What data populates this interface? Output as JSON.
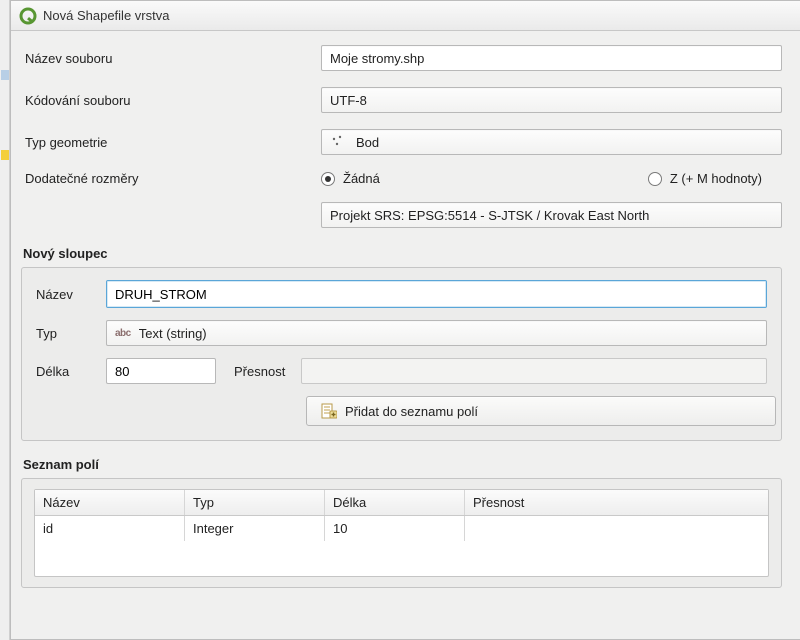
{
  "window": {
    "title": "Nová Shapefile vrstva"
  },
  "labels": {
    "filename": "Název souboru",
    "encoding": "Kódování souboru",
    "geometry": "Typ geometrie",
    "dims": "Dodatečné rozměry",
    "newfield_group": "Nový sloupec",
    "name": "Název",
    "type": "Typ",
    "length": "Délka",
    "precision": "Přesnost",
    "addfield": "Přidat do seznamu polí",
    "fieldlist_group": "Seznam polí"
  },
  "values": {
    "filename": "Moje stromy.shp",
    "encoding": "UTF-8",
    "geometry": "Bod",
    "dims_none": "Žádná",
    "dims_z": "Z (+ M hodnoty)",
    "crs": "Projekt SRS: EPSG:5514 - S-JTSK / Krovak East North",
    "newfield_name": "DRUH_STROM",
    "newfield_type_prefix": "abc",
    "newfield_type": "Text (string)",
    "newfield_length": "80"
  },
  "table": {
    "headers": {
      "name": "Název",
      "type": "Typ",
      "length": "Délka",
      "precision": "Přesnost"
    },
    "rows": [
      {
        "name": "id",
        "type": "Integer",
        "length": "10",
        "precision": ""
      }
    ]
  }
}
